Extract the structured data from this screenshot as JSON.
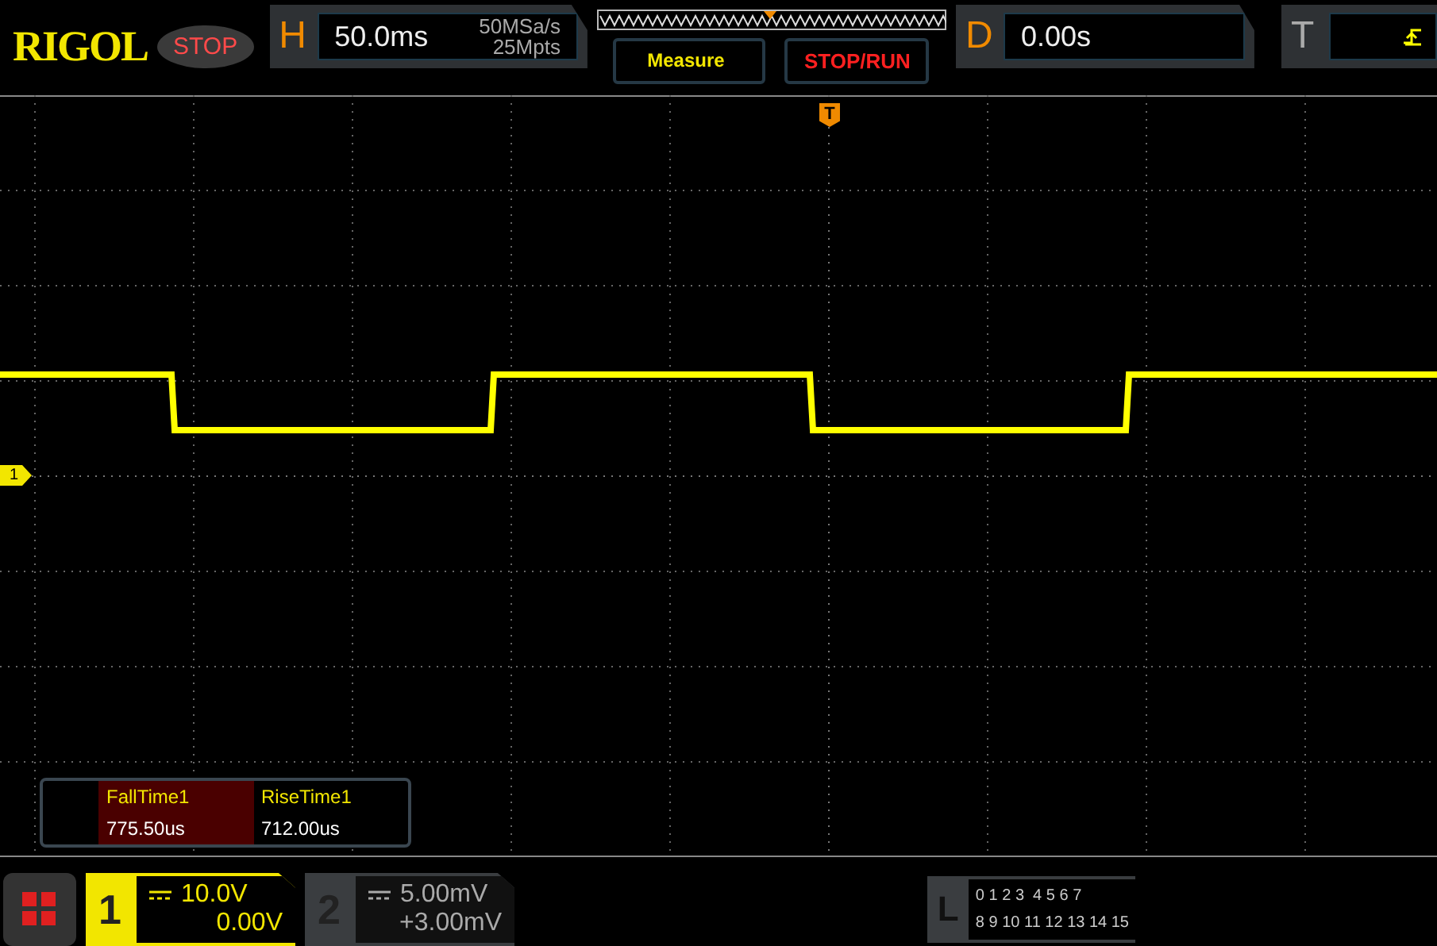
{
  "brand": "RIGOL",
  "run_state": "STOP",
  "horizontal": {
    "label": "H",
    "timebase": "50.0ms",
    "sample_rate": "50MSa/s",
    "memory_depth": "25Mpts"
  },
  "buttons": [
    {
      "label": "Measure",
      "kind": "measure"
    },
    {
      "label": "STOP/RUN",
      "kind": "run"
    }
  ],
  "delay": {
    "label": "D",
    "value": "0.00s"
  },
  "trigger": {
    "label": "T"
  },
  "trigger_marker": "T",
  "channel_marker": "1",
  "measurements": [
    {
      "name": "FallTime1",
      "value": "775.50us",
      "selected": true
    },
    {
      "name": "RiseTime1",
      "value": "712.00us",
      "selected": false
    }
  ],
  "channels": [
    {
      "number": "1",
      "scale": "10.0V",
      "offset": "0.00V",
      "selected": true
    },
    {
      "number": "2",
      "scale": "5.00mV",
      "offset": "+3.00mV",
      "selected": false
    }
  ],
  "logic": {
    "label": "L",
    "rows": [
      "0 1 2 3  4 5 6 7",
      "8 9 10 11 12 13 14 15"
    ]
  }
}
